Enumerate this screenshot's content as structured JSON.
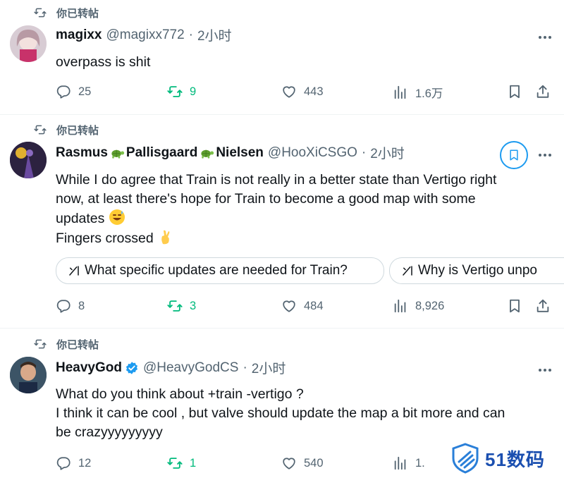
{
  "retweet_label": "你已转帖",
  "tweets": [
    {
      "name": "magixx",
      "handle": "@magixx772",
      "time": "2小时",
      "lines": [
        "overpass is shit"
      ],
      "replies": "25",
      "reposts": "9",
      "likes": "443",
      "views": "1.6万"
    },
    {
      "name_parts": [
        "Rasmus",
        "Pallisgaard",
        "Nielsen"
      ],
      "handle": "@HooXiCSGO",
      "time": "2小时",
      "lines": [
        "While I do agree that Train is not really in a better state than Vertigo right",
        "now, at least there's hope for Train to become a good map with some",
        "updates",
        "Fingers crossed"
      ],
      "suggestions": [
        "What specific updates are needed for Train?",
        "Why is Vertigo unpo"
      ],
      "replies": "8",
      "reposts": "3",
      "likes": "484",
      "views": "8,926"
    },
    {
      "name": "HeavyGod",
      "handle": "@HeavyGodCS",
      "time": "2小时",
      "lines": [
        "What do you think about +train -vertigo ?",
        "I think it can be cool , but valve should update the map a bit more and can",
        "be crazyyyyyyyyy"
      ],
      "replies": "12",
      "reposts": "1",
      "likes": "540",
      "views": "1."
    }
  ],
  "watermark": "51数码",
  "colors": {
    "repost_green": "#00ba7c",
    "muted": "#536471",
    "accent": "#1d9bf0"
  }
}
